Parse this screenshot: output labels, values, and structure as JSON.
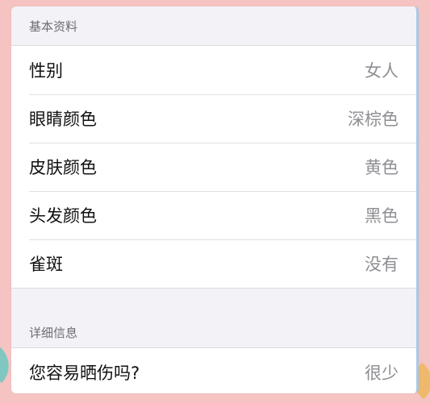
{
  "basic": {
    "header": "基本资料",
    "rows": [
      {
        "label": "性别",
        "value": "女人"
      },
      {
        "label": "眼睛颜色",
        "value": "深棕色"
      },
      {
        "label": "皮肤颜色",
        "value": "黄色"
      },
      {
        "label": "头发颜色",
        "value": "黑色"
      },
      {
        "label": "雀斑",
        "value": "没有"
      }
    ]
  },
  "detail": {
    "header": "详细信息",
    "rows": [
      {
        "label": "您容易晒伤吗?",
        "value": "很少"
      }
    ]
  },
  "colors": {
    "background": "#f4c3c2",
    "panel": "#f2f2f7",
    "label_text": "#111111",
    "value_text": "#8e8e93",
    "header_text": "#6d6d72"
  }
}
